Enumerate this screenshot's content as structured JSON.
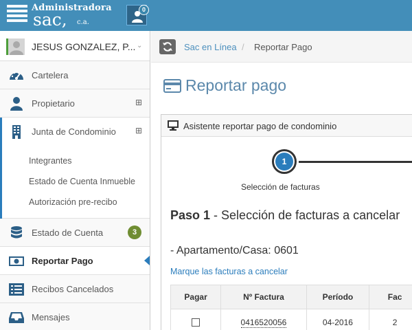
{
  "header": {
    "logo_title": "Administradora",
    "logo_brand": "sac,",
    "logo_suffix": "c.a.",
    "notifications": "0"
  },
  "sidebar": {
    "user_name": "JESUS GONZALEZ, P...",
    "items": [
      {
        "label": "Cartelera",
        "icon": "tachometer-icon"
      },
      {
        "label": "Propietario",
        "icon": "user-icon",
        "expand": "⊞"
      },
      {
        "label": "Junta de Condominio",
        "icon": "building-icon",
        "expand": "⊞",
        "children": [
          "Integrantes",
          "Estado de Cuenta Inmueble",
          "Autorización pre-recibo"
        ]
      },
      {
        "label": "Estado de Cuenta",
        "icon": "database-icon",
        "badge": "3"
      },
      {
        "label": "Reportar Pago",
        "icon": "money-icon",
        "active": true
      },
      {
        "label": "Recibos Cancelados",
        "icon": "list-icon"
      },
      {
        "label": "Mensajes",
        "icon": "inbox-icon"
      }
    ]
  },
  "breadcrumb": {
    "home": "Sac en Línea",
    "separator": "/",
    "current": "Reportar Pago"
  },
  "page": {
    "title": "Reportar pago"
  },
  "wizard": {
    "title": "Asistente reportar pago de condominio",
    "step_number": "1",
    "step_label": "Selección de facturas",
    "step_heading_bold": "Paso 1",
    "step_heading_rest": " - Selección de facturas a cancelar",
    "unit": "- Apartamento/Casa: 0601",
    "instruction": "Marque las facturas a cancelar"
  },
  "table": {
    "headers": [
      "Pagar",
      "Nº Factura",
      "Período",
      "Fac"
    ],
    "rows": [
      {
        "factura": "0416520056",
        "periodo": "04-2016",
        "fac": "2"
      }
    ]
  },
  "colors": {
    "topbar": "#438eb9",
    "accent": "#2b7dbc",
    "badge": "#6f8d32"
  }
}
